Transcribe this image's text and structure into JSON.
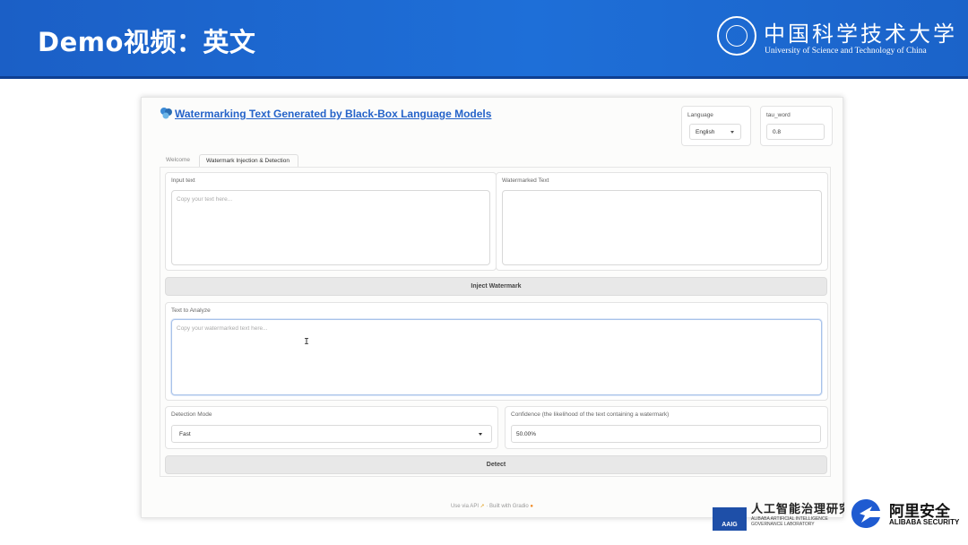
{
  "slide": {
    "title": "Demo视频：英文",
    "university_cn": "中国科学技术大学",
    "university_en": "University of Science and Technology of China"
  },
  "app": {
    "title": "Watermarking Text Generated by Black-Box Language Models",
    "language": {
      "label": "Language",
      "value": "English"
    },
    "tau_word": {
      "label": "tau_word",
      "value": "0.8"
    },
    "tabs": [
      {
        "label": "Welcome",
        "active": false
      },
      {
        "label": "Watermark Injection & Detection",
        "active": true
      }
    ],
    "input_text": {
      "label": "Input text",
      "placeholder": "Copy your text here..."
    },
    "watermarked_text": {
      "label": "Watermarked Text",
      "value": ""
    },
    "inject_button": "Inject Watermark",
    "text_to_analyze": {
      "label": "Text to Analyze",
      "placeholder": "Copy your watermarked text here..."
    },
    "detection_mode": {
      "label": "Detection Mode",
      "value": "Fast"
    },
    "confidence": {
      "label": "Confidence (the likelihood of the text containing a watermark)",
      "value": "50.00%"
    },
    "detect_button": "Detect",
    "footer": {
      "api": "Use via API",
      "sep": "·",
      "built": "Built with Gradio"
    }
  },
  "logos": {
    "aaig": "AAIG",
    "aaig_cn": "人工智能治理研究中心",
    "aaig_en_1": "ALIBABA ARTIFICIAL INTELLIGENCE",
    "aaig_en_2": "GOVERNANCE LABORATORY",
    "alibaba_cn": "阿里安全",
    "alibaba_en": "ALIBABA SECURITY"
  },
  "colors": {
    "banner": "#1e6fd8",
    "link": "#2563c9",
    "aaig": "#1e4fa8"
  }
}
